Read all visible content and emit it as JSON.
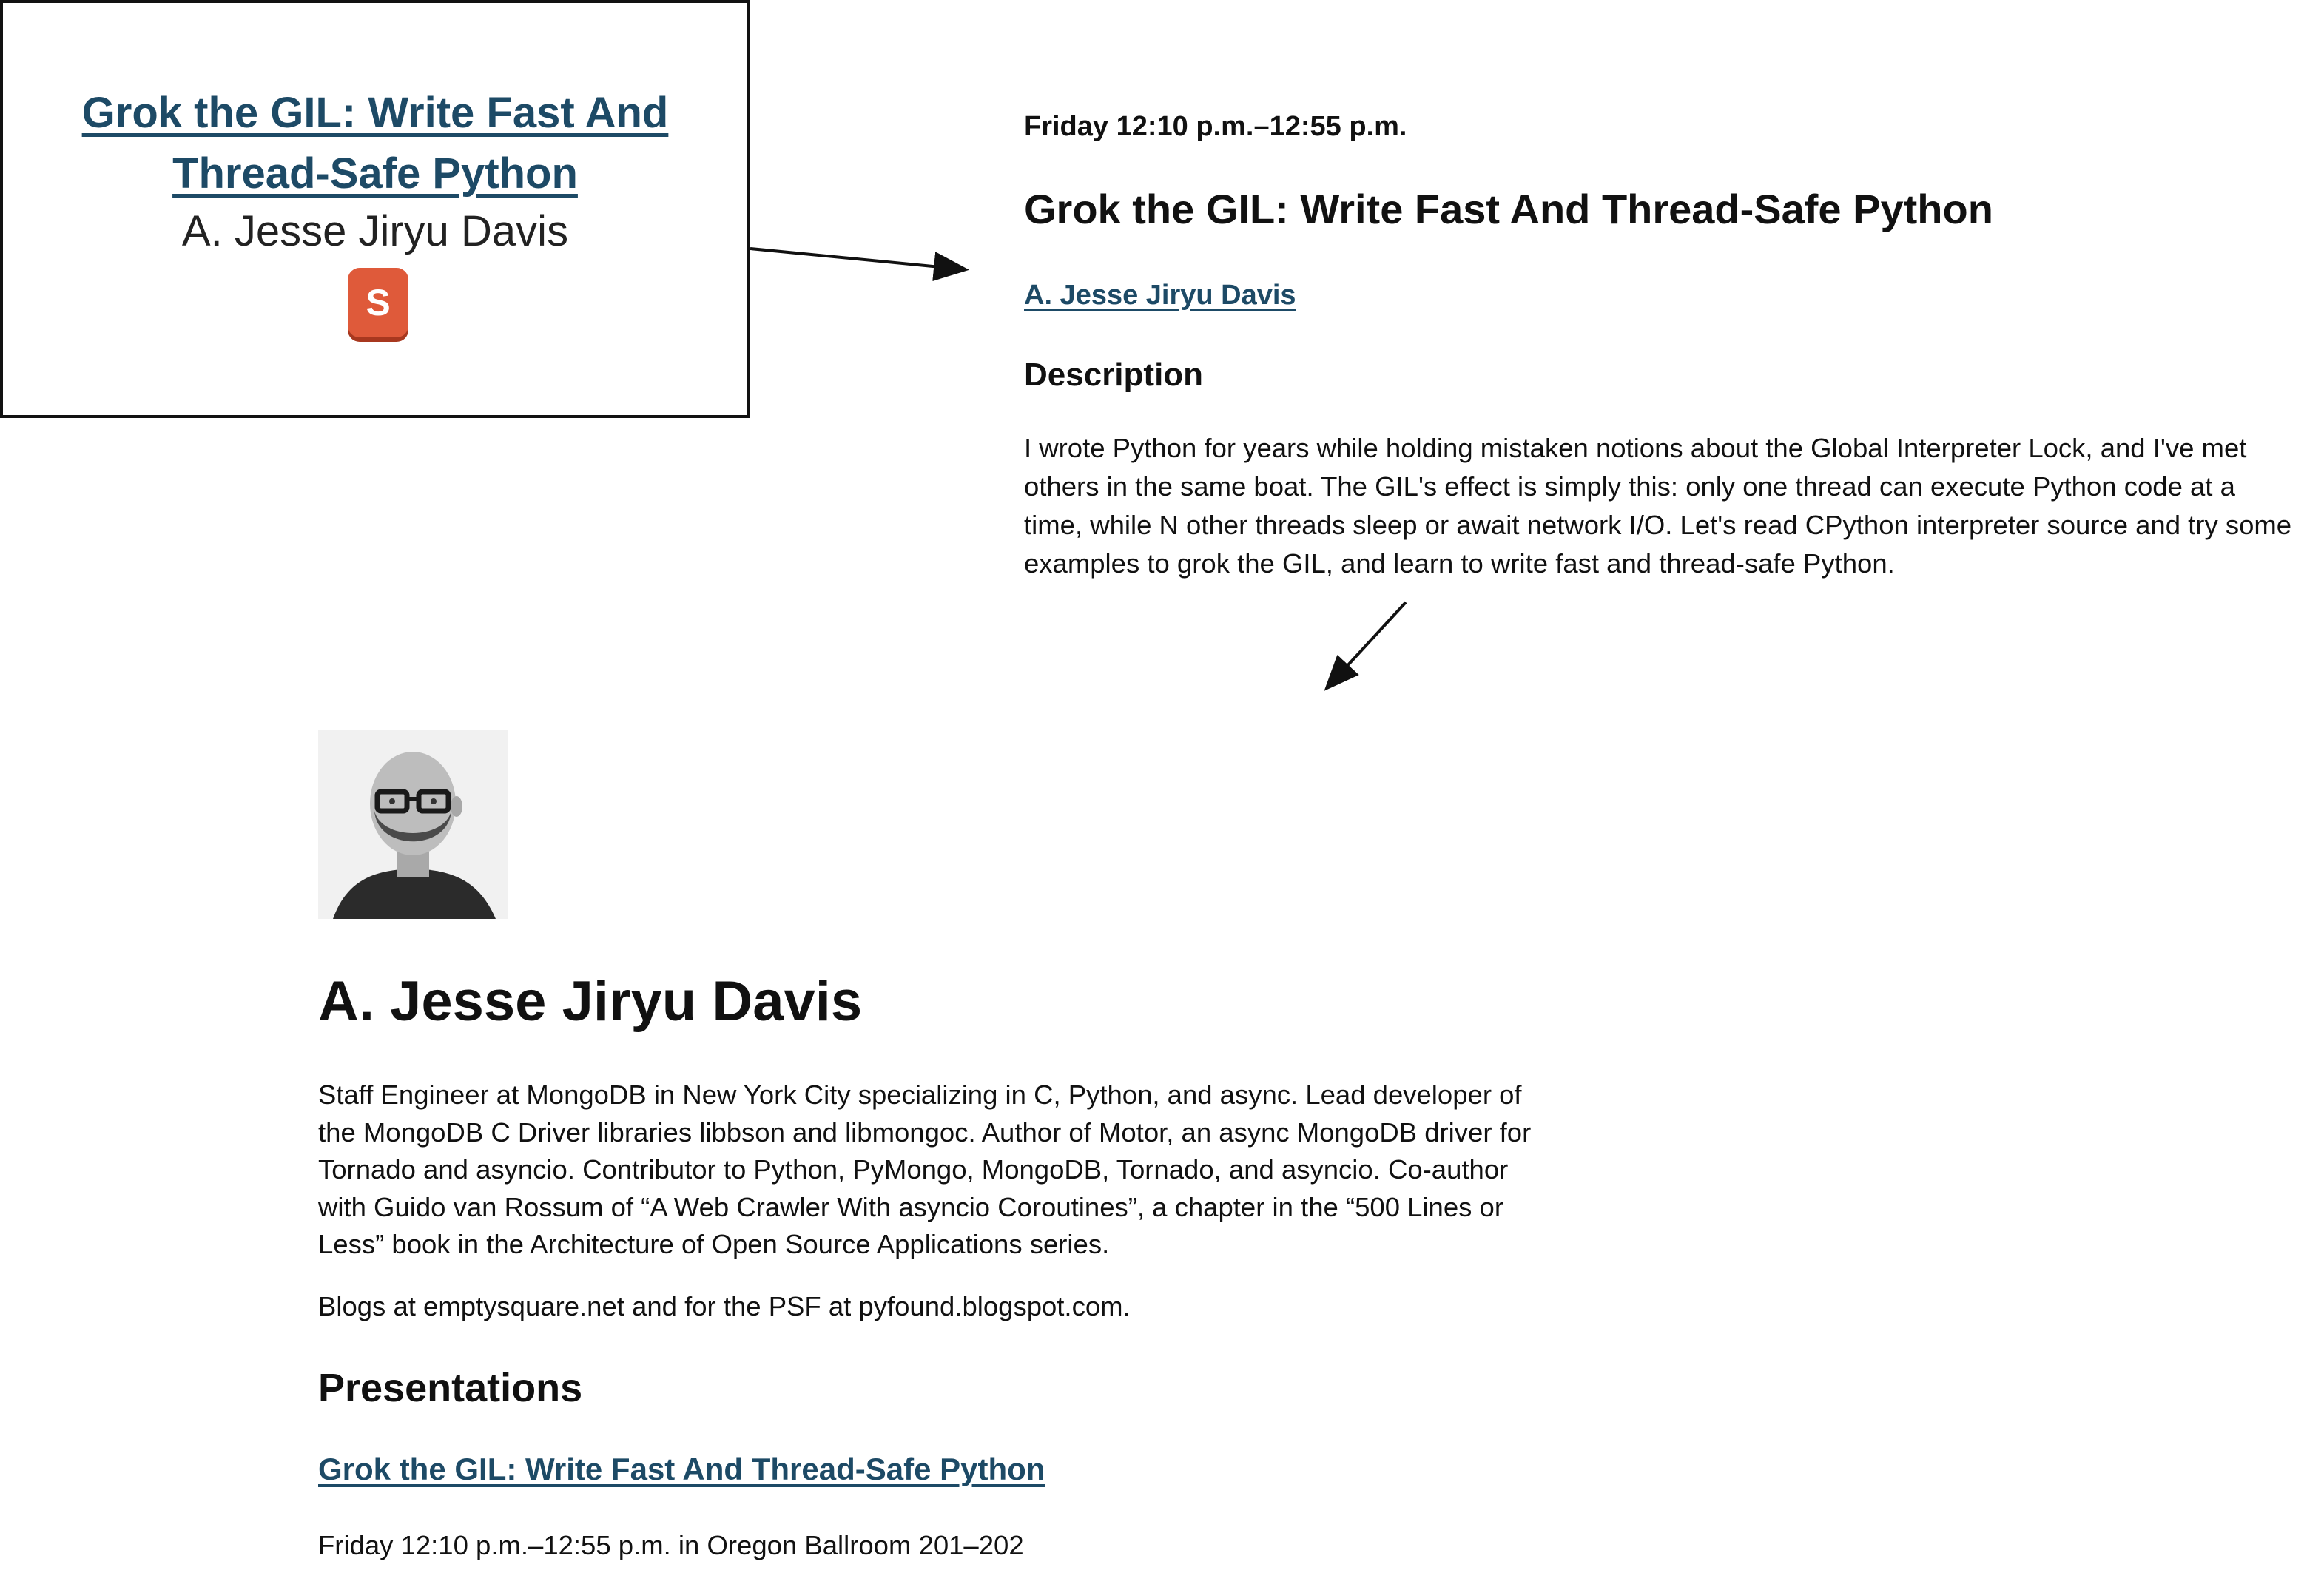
{
  "card": {
    "title": "Grok the GIL: Write Fast And Thread-Safe Python",
    "speaker": "A. Jesse Jiryu Davis",
    "slides_icon": "slideshare-icon",
    "slides_letter": "S",
    "slides_color": "#df5a3a"
  },
  "session": {
    "time": "Friday 12:10 p.m.–12:55 p.m.",
    "title": "Grok the GIL: Write Fast And Thread-Safe Python",
    "speaker_link": "A. Jesse Jiryu Davis",
    "description_heading": "Description",
    "description": "I wrote Python for years while holding mistaken notions about the Global Interpreter Lock, and I've met others in the same boat. The GIL's effect is simply this: only one thread can execute Python code at a time, while N other threads sleep or await network I/O. Let's read CPython interpreter source and try some examples to grok the GIL, and learn to write fast and thread-safe Python."
  },
  "speaker": {
    "name": "A. Jesse Jiryu Davis",
    "bio": "Staff Engineer at MongoDB in New York City specializing in C, Python, and async. Lead developer of the MongoDB C Driver libraries libbson and libmongoc. Author of Motor, an async MongoDB driver for Tornado and asyncio. Contributor to Python, PyMongo, MongoDB, Tornado, and asyncio. Co-author with Guido van Rossum of “A Web Crawler With asyncio Coroutines”, a chapter in the “500 Lines or Less” book in the Architecture of Open Source Applications series.",
    "blogs": "Blogs at emptysquare.net and for the PSF at pyfound.blogspot.com.",
    "presentations_heading": "Presentations",
    "presentation_title": "Grok the GIL: Write Fast And Thread-Safe Python",
    "presentation_time": "Friday 12:10 p.m.–12:55 p.m. in Oregon Ballroom 201–202"
  },
  "colors": {
    "link": "#1d4a66",
    "text": "#111111"
  }
}
